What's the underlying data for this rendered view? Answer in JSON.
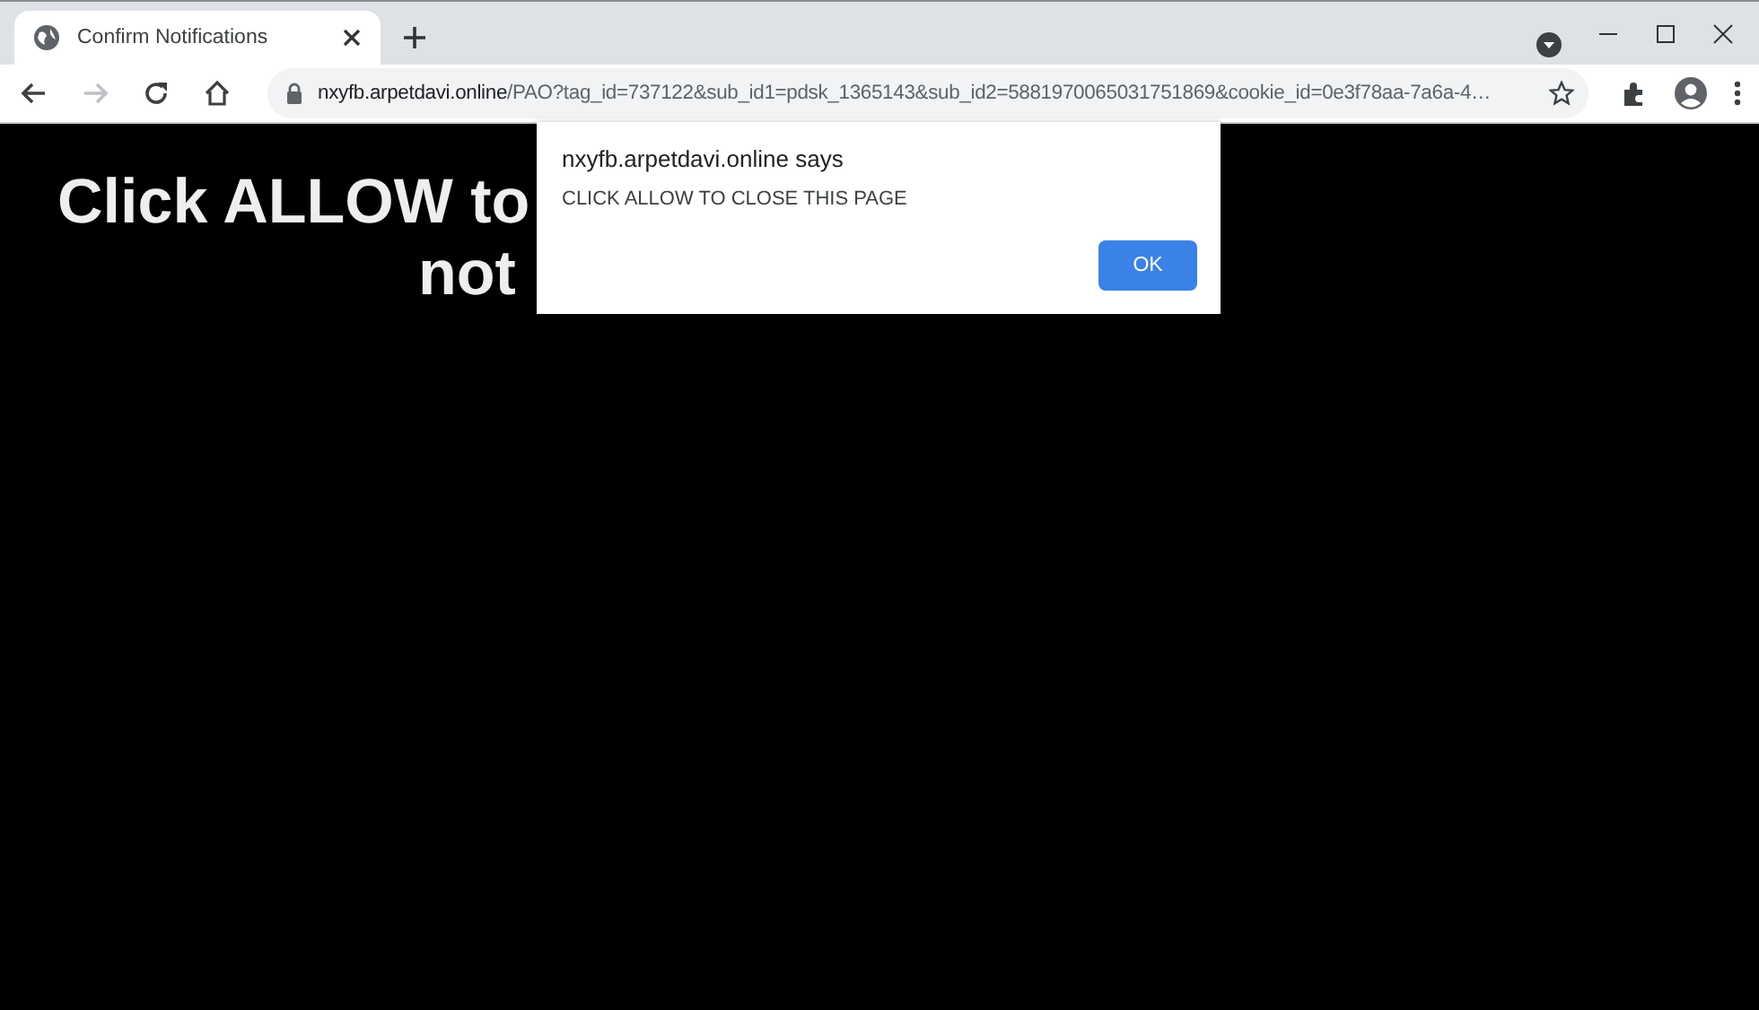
{
  "tabs": [
    {
      "title": "Confirm Notifications",
      "selected": true
    }
  ],
  "toolbar": {
    "back_disabled": false,
    "forward_disabled": true
  },
  "address_bar": {
    "host": "nxyfb.arpetdavi.online",
    "path": "/PAO?tag_id=737122&sub_id1=pdsk_1365143&sub_id2=5881970065031751869&cookie_id=0e3f78aa-7a6a-4…"
  },
  "page": {
    "headline_lines": [
      "Click ALLOW to",
      "not"
    ]
  },
  "dialog": {
    "title": "nxyfb.arpetdavi.online says",
    "message": "CLICK ALLOW TO CLOSE THIS PAGE",
    "buttons": [
      "OK"
    ]
  }
}
